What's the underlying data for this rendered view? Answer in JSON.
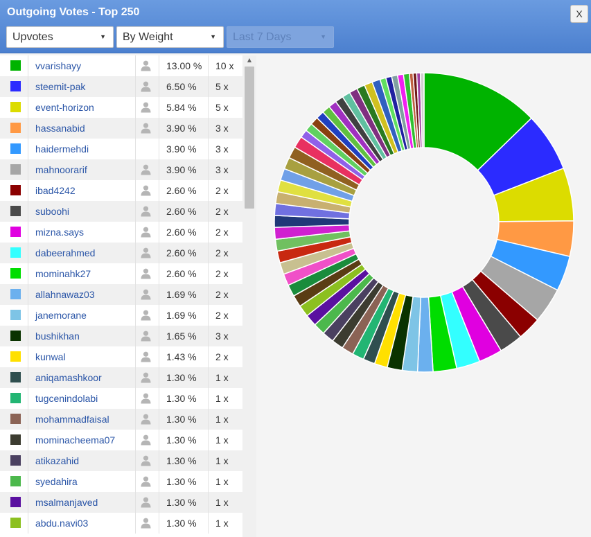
{
  "window": {
    "title": "Outgoing Votes - Top 250",
    "close_label": "X"
  },
  "filters": {
    "vote_type": "Upvotes",
    "sort": "By Weight",
    "period": "Last 7 Days"
  },
  "icons": {
    "user": "user-icon",
    "dropdown": "chevron-down-icon",
    "scroll_up": "arrow-up-icon"
  },
  "list": {
    "rows": [
      {
        "color": "#00b300",
        "name": "vvarishayy",
        "pct": "13.00 %",
        "count": "10 x",
        "has_user_icon": true
      },
      {
        "color": "#2b2bff",
        "name": "steemit-pak",
        "pct": "6.50 %",
        "count": "5 x",
        "has_user_icon": true
      },
      {
        "color": "#dcdc00",
        "name": "event-horizon",
        "pct": "5.84 %",
        "count": "5 x",
        "has_user_icon": true
      },
      {
        "color": "#ff9944",
        "name": "hassanabid",
        "pct": "3.90 %",
        "count": "3 x",
        "has_user_icon": true
      },
      {
        "color": "#3399ff",
        "name": "haidermehdi",
        "pct": "3.90 %",
        "count": "3 x",
        "has_user_icon": false
      },
      {
        "color": "#a6a6a6",
        "name": "mahnoorarif",
        "pct": "3.90 %",
        "count": "3 x",
        "has_user_icon": true
      },
      {
        "color": "#8b0000",
        "name": "ibad4242",
        "pct": "2.60 %",
        "count": "2 x",
        "has_user_icon": true
      },
      {
        "color": "#4a4a4a",
        "name": "suboohi",
        "pct": "2.60 %",
        "count": "2 x",
        "has_user_icon": true
      },
      {
        "color": "#e000e0",
        "name": "mizna.says",
        "pct": "2.60 %",
        "count": "2 x",
        "has_user_icon": true
      },
      {
        "color": "#33ffff",
        "name": "dabeerahmed",
        "pct": "2.60 %",
        "count": "2 x",
        "has_user_icon": true
      },
      {
        "color": "#00dd00",
        "name": "mominahk27",
        "pct": "2.60 %",
        "count": "2 x",
        "has_user_icon": true
      },
      {
        "color": "#6bb0ee",
        "name": "allahnawaz03",
        "pct": "1.69 %",
        "count": "2 x",
        "has_user_icon": true
      },
      {
        "color": "#7ec4e6",
        "name": "janemorane",
        "pct": "1.69 %",
        "count": "2 x",
        "has_user_icon": true
      },
      {
        "color": "#0a3300",
        "name": "bushikhan",
        "pct": "1.65 %",
        "count": "3 x",
        "has_user_icon": true
      },
      {
        "color": "#ffe000",
        "name": "kunwal",
        "pct": "1.43 %",
        "count": "2 x",
        "has_user_icon": true
      },
      {
        "color": "#2f4f4f",
        "name": "aniqamashkoor",
        "pct": "1.30 %",
        "count": "1 x",
        "has_user_icon": true
      },
      {
        "color": "#22b573",
        "name": "tugcenindolabi",
        "pct": "1.30 %",
        "count": "1 x",
        "has_user_icon": true
      },
      {
        "color": "#8b6355",
        "name": "mohammadfaisal",
        "pct": "1.30 %",
        "count": "1 x",
        "has_user_icon": true
      },
      {
        "color": "#3c3c30",
        "name": "mominacheema07",
        "pct": "1.30 %",
        "count": "1 x",
        "has_user_icon": true
      },
      {
        "color": "#4a4060",
        "name": "atikazahid",
        "pct": "1.30 %",
        "count": "1 x",
        "has_user_icon": true
      },
      {
        "color": "#4cb84c",
        "name": "syedahira",
        "pct": "1.30 %",
        "count": "1 x",
        "has_user_icon": true
      },
      {
        "color": "#5a10a0",
        "name": "msalmanjaved",
        "pct": "1.30 %",
        "count": "1 x",
        "has_user_icon": true
      },
      {
        "color": "#8cc020",
        "name": "abdu.navi03",
        "pct": "1.30 %",
        "count": "1 x",
        "has_user_icon": true
      }
    ]
  },
  "chart_data": {
    "type": "pie",
    "donut": true,
    "labels": [
      "vvarishayy",
      "steemit-pak",
      "event-horizon",
      "hassanabid",
      "haidermehdi",
      "mahnoorarif",
      "ibad4242",
      "suboohi",
      "mizna.says",
      "dabeerahmed",
      "mominahk27",
      "allahnawaz03",
      "janemorane",
      "bushikhan",
      "kunwal",
      "aniqamashkoor",
      "tugcenindolabi",
      "mohammadfaisal",
      "mominacheema07",
      "atikazahid",
      "syedahira",
      "msalmanjaved",
      "abdu.navi03"
    ],
    "values": [
      13.0,
      6.5,
      5.84,
      3.9,
      3.9,
      3.9,
      2.6,
      2.6,
      2.6,
      2.6,
      2.6,
      1.69,
      1.69,
      1.65,
      1.43,
      1.3,
      1.3,
      1.3,
      1.3,
      1.3,
      1.3,
      1.3,
      1.3
    ],
    "colors": [
      "#00b300",
      "#2b2bff",
      "#dcdc00",
      "#ff9944",
      "#3399ff",
      "#a6a6a6",
      "#8b0000",
      "#4a4a4a",
      "#e000e0",
      "#33ffff",
      "#00dd00",
      "#6bb0ee",
      "#7ec4e6",
      "#0a3300",
      "#ffe000",
      "#2f4f4f",
      "#22b573",
      "#8b6355",
      "#3c3c30",
      "#4a4060",
      "#4cb84c",
      "#5a10a0",
      "#8cc020"
    ],
    "remaining_slices": {
      "values": [
        1.3,
        1.3,
        1.3,
        1.3,
        1.3,
        1.3,
        1.3,
        1.3,
        1.3,
        1.3,
        1.3,
        1.3,
        1.3,
        1.3,
        1.3,
        0.9,
        0.9,
        0.9,
        0.9,
        0.9,
        0.9,
        0.9,
        0.9,
        0.9,
        0.9,
        0.9,
        0.9,
        0.65,
        0.65,
        0.65,
        0.65,
        0.65,
        0.4,
        0.4,
        0.4,
        0.4
      ],
      "colors": [
        "#5a3c14",
        "#1a8c3c",
        "#f050c8",
        "#c8c090",
        "#c82810",
        "#70c060",
        "#d020d0",
        "#203878",
        "#7070e0",
        "#c8b070",
        "#e0e040",
        "#70a0e8",
        "#a8a040",
        "#906020",
        "#e83060",
        "#9060e8",
        "#60d060",
        "#8a4010",
        "#2040c0",
        "#60c040",
        "#a030c0",
        "#404040",
        "#60c0a0",
        "#803080",
        "#2a7a20",
        "#d0c020",
        "#3060c0",
        "#60e060",
        "#2020a0",
        "#80a0a0",
        "#f020f0",
        "#30c030",
        "#c06040",
        "#701818",
        "#a040a0",
        "#d0d0d0"
      ]
    }
  }
}
